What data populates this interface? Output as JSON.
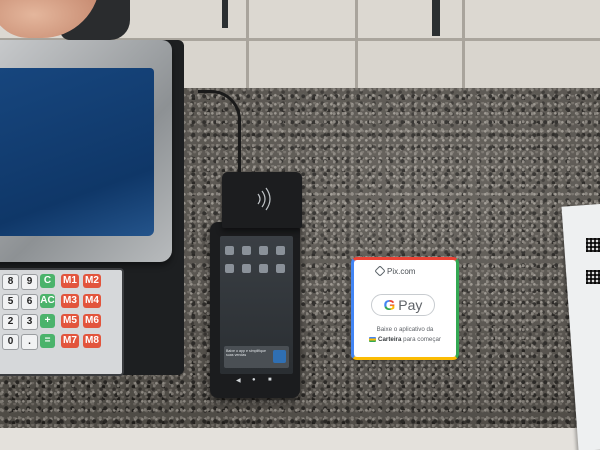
{
  "scale": {
    "keypad_keys": [
      "8",
      "9",
      "C",
      "M1",
      "M2",
      "5",
      "6",
      "AC",
      "M3",
      "M4",
      "2",
      "3",
      "+",
      "M5",
      "M6",
      "0",
      ".",
      "=",
      "M7",
      "M8"
    ]
  },
  "pos_terminal": {
    "banner_text": "Baixe o app e simplifique suas vendas",
    "nav_icons": [
      "back-icon",
      "home-icon",
      "recent-apps-icon"
    ]
  },
  "sticker": {
    "brand": "Pix.com",
    "pay_letter": "G",
    "pay_word": "Pay",
    "line1": "Baixe o aplicativo da",
    "line2_bold": "Carteira",
    "line2_rest": " para começar",
    "colors": {
      "red": "#ea4335",
      "blue": "#4285f4",
      "green": "#34a853",
      "yellow": "#fbbc04"
    }
  }
}
